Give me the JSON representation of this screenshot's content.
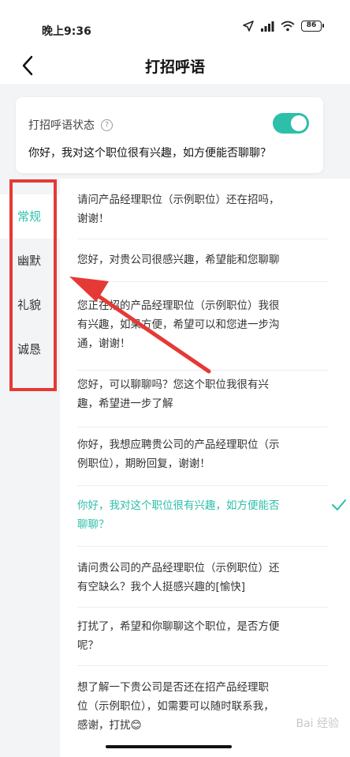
{
  "status_bar": {
    "time": "晚上9:36",
    "battery": "86",
    "icons": [
      "location-icon",
      "signal-icon",
      "wifi-icon",
      "battery-icon"
    ]
  },
  "nav": {
    "title": "打招呼语",
    "back_icon": "chevron-left-icon"
  },
  "greeting_status": {
    "label": "打招呼语状态",
    "help": "?",
    "enabled": true,
    "current_text": "你好，我对这个职位很有兴趣，如方便能否聊聊？"
  },
  "categories": [
    {
      "label": "常规",
      "active": true
    },
    {
      "label": "幽默",
      "active": false
    },
    {
      "label": "礼貌",
      "active": false
    },
    {
      "label": "诚恳",
      "active": false
    }
  ],
  "messages": [
    {
      "line1": "请问产品经理职位（示例职位）还在招吗，",
      "line2": "谢谢！",
      "selected": false
    },
    {
      "line1": "您好，对贵公司很感兴趣，希望能和您聊聊",
      "line2": "",
      "selected": false
    },
    {
      "line1": "您正在招的产品经理职位（示例职位）我很",
      "line2": "有兴趣，如果方便，希望可以和您进一步沟",
      "line3": "通，谢谢！",
      "selected": false
    },
    {
      "line1": "您好，可以聊聊吗？您这个职位我很有兴",
      "line2": "趣，希望进一步了解",
      "selected": false
    },
    {
      "line1": "你好，我想应聘贵公司的产品经理职位（示",
      "line2": "例职位），期盼回复，谢谢！",
      "selected": false
    },
    {
      "line1": "你好，我对这个职位很有兴趣，如方便能否",
      "line2": "聊聊？",
      "selected": true
    },
    {
      "line1": "请问贵公司的产品经理职位（示例职位）还",
      "line2": "有空缺么？我个人挺感兴趣的[愉快]",
      "selected": false
    },
    {
      "line1": "打扰了，希望和你聊聊这个职位，是否方便",
      "line2": "呢？",
      "selected": false
    },
    {
      "line1": "想了解一下贵公司是否还在招产品经理职",
      "line2": "位（示例职位），如需要可以随时联系我，",
      "line3": "感谢，打扰😊",
      "selected": false
    }
  ],
  "colors": {
    "accent": "#2dbfa9",
    "annotation": "#e53935"
  },
  "watermark": "Bai 经验"
}
